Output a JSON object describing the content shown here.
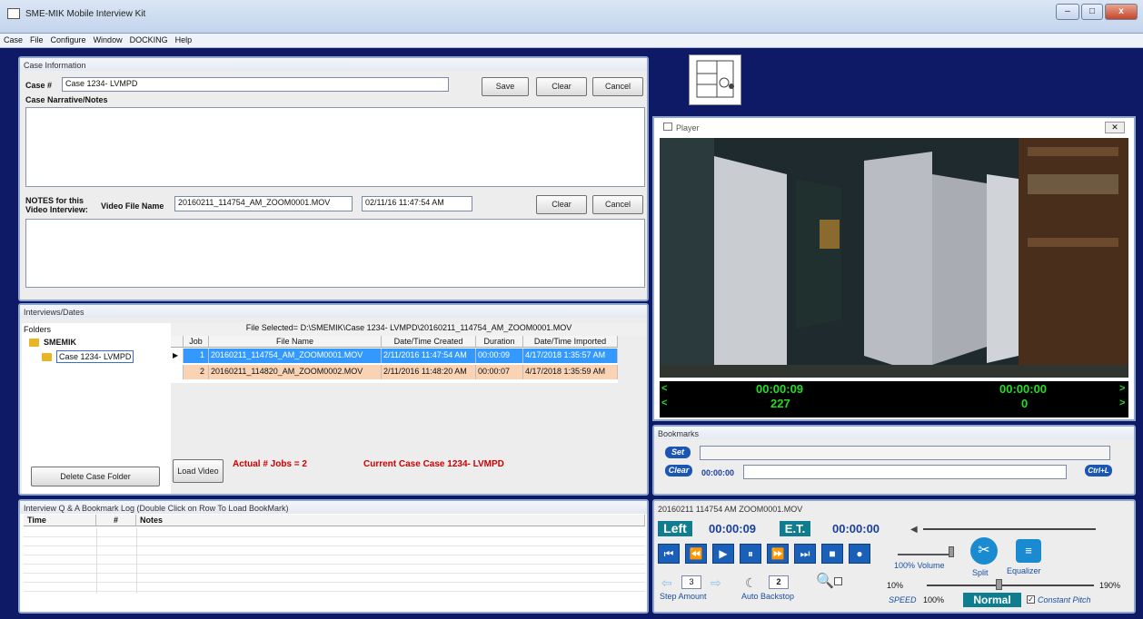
{
  "window": {
    "title": "SME-MIK Mobile Interview Kit",
    "min": "–",
    "max": "□",
    "close": "x"
  },
  "menu": [
    "Case",
    "File",
    "Configure",
    "Window",
    "DOCKING",
    "Help"
  ],
  "case_info": {
    "header": "Case Information",
    "case_label": "Case #",
    "case_value": "Case 1234- LVMPD",
    "save": "Save",
    "clear": "Clear",
    "cancel": "Cancel",
    "narrative_label": "Case Narrative/Notes",
    "notes_label_1": "NOTES for this",
    "notes_label_2": "Video Interview:",
    "video_file_label": "Video File Name",
    "video_file_value": "20160211_114754_AM_ZOOM0001.MOV",
    "video_date_value": "02/11/16 11:47:54 AM",
    "clear2": "Clear",
    "cancel2": "Cancel"
  },
  "interviews": {
    "header": "Interviews/Dates",
    "folders_label": "Folders",
    "root": "SMEMIK",
    "child": "Case 1234- LVMPD",
    "file_selected": "File Selected= D:\\SMEMIK\\Case 1234- LVMPD\\20160211_114754_AM_ZOOM0001.MOV",
    "columns": [
      "Job",
      "File Name",
      "Date/Time Created",
      "Duration",
      "Date/Time Imported"
    ],
    "rows": [
      {
        "job": "1",
        "file": "20160211_114754_AM_ZOOM0001.MOV",
        "created": "2/11/2016 11:47:54 AM",
        "duration": "00:00:09",
        "imported": "4/17/2018 1:35:57 AM"
      },
      {
        "job": "2",
        "file": "20160211_114820_AM_ZOOM0002.MOV",
        "created": "2/11/2016 11:48:20 AM",
        "duration": "00:00:07",
        "imported": "4/17/2018 1:35:59 AM"
      }
    ],
    "delete_btn": "Delete Case Folder",
    "load_btn": "Load Video",
    "actual_jobs": "Actual # Jobs = 2",
    "current_case": "Current Case Case 1234- LVMPD"
  },
  "log": {
    "header": "Interview Q & A Bookmark Log (Double Click on Row To Load BookMark)",
    "columns": [
      "Time",
      "#",
      "Notes"
    ]
  },
  "player": {
    "header": "Player",
    "tc_left": "00:00:09",
    "tc_right": "00:00:00",
    "frame_left": "227",
    "frame_right": "0",
    "arrow_l": "<",
    "arrow_r": ">"
  },
  "bookmarks": {
    "header": "Bookmarks",
    "set": "Set",
    "clear": "Clear",
    "time": "00:00:00",
    "ctrl": "Ctrl+L"
  },
  "controls": {
    "file": "20160211 114754 AM ZOOM0001.MOV",
    "left": "Left",
    "left_time": "00:00:09",
    "et": "E.T.",
    "et_time": "00:00:00",
    "volume": "100% Volume",
    "split": "Split",
    "equalizer": "Equalizer",
    "step_value": "3",
    "step_label": "Step Amount",
    "backstop_value": "2",
    "backstop_label": "Auto Backstop",
    "speed_min": "10%",
    "speed_max": "190%",
    "speed_label": "SPEED",
    "speed_value": "100%",
    "normal": "Normal",
    "constant_pitch": "Constant Pitch"
  }
}
